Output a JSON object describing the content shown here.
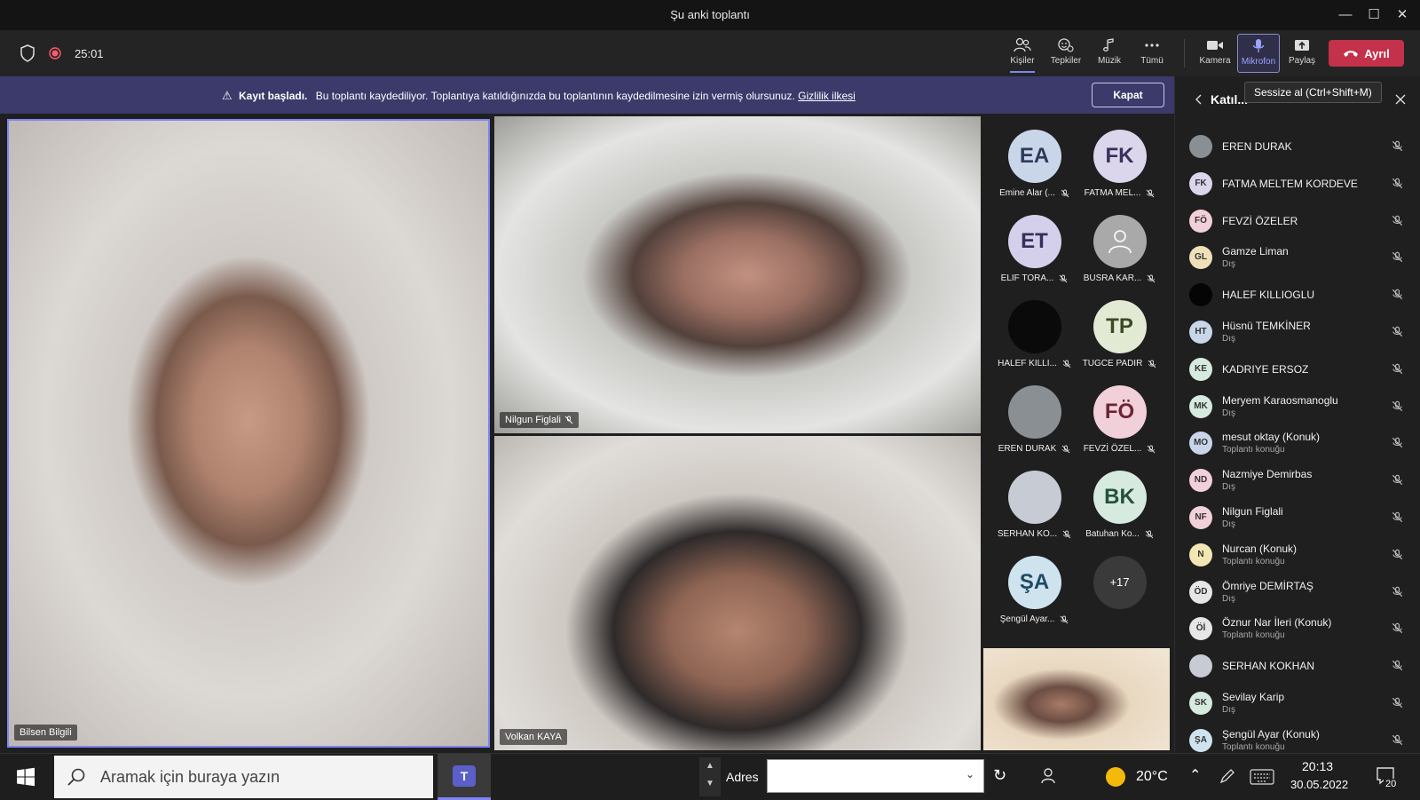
{
  "window": {
    "title": "Şu anki toplantı"
  },
  "toolbar": {
    "timer": "25:01",
    "buttons": {
      "people": "Kişiler",
      "reactions": "Tepkiler",
      "music": "Müzik",
      "more": "Tümü",
      "camera": "Kamera",
      "mic": "Mikrofon",
      "share": "Paylaş"
    },
    "leave": "Ayrıl"
  },
  "banner": {
    "bold": "Kayıt başladı.",
    "text": "Bu toplantı kaydediliyor. Toplantıya katıldığınızda bu toplantının kaydedilmesine izin vermiş olursunuz.",
    "link": "Gizlilik ilkesi",
    "close": "Kapat"
  },
  "videos": {
    "main": "Bilsen Bilgili",
    "top": "Nilgun Figlali",
    "bottom": "Volkan KAYA"
  },
  "gallery": [
    {
      "initials": "EA",
      "label": "Emine Alar (...",
      "bg": "#c9d6ea",
      "fg": "#2d3a59"
    },
    {
      "initials": "FK",
      "label": "FATMA MEL...",
      "bg": "#dcd6ec",
      "fg": "#3b2f5c"
    },
    {
      "initials": "ET",
      "label": "ELIF TORA...",
      "bg": "#d4d0ec",
      "fg": "#34305a"
    },
    {
      "initials": "",
      "label": "BUSRA KAR...",
      "bg": "#a9a9a9",
      "fg": "#ffffff"
    },
    {
      "initials": "",
      "label": "HALEF KILLI...",
      "bg": "#0a0a0a",
      "fg": "#ffffff"
    },
    {
      "initials": "TP",
      "label": "TUGCE PADIR",
      "bg": "#e3ead4",
      "fg": "#3b4a25"
    },
    {
      "initials": "",
      "label": "EREN DURAK",
      "bg": "#8a8f94",
      "fg": "#ffffff"
    },
    {
      "initials": "FÖ",
      "label": "FEVZİ ÖZEL...",
      "bg": "#f2d0d9",
      "fg": "#6b2335"
    },
    {
      "initials": "",
      "label": "SERHAN KO...",
      "bg": "#c7ccd4",
      "fg": "#ffffff"
    },
    {
      "initials": "BK",
      "label": "Batuhan Ko...",
      "bg": "#d6eadf",
      "fg": "#24513a"
    },
    {
      "initials": "ŞA",
      "label": "Şengül Ayar...",
      "bg": "#cfe3ef",
      "fg": "#1f4a62"
    },
    {
      "initials": "+17",
      "label": "",
      "bg": "#3a3a3a",
      "fg": "#ffffff"
    }
  ],
  "panel": {
    "title": "Katıl...",
    "tooltip": "Sessize al (Ctrl+Shift+M)",
    "participants": [
      {
        "initials": "",
        "name": "EREN DURAK",
        "sub": "",
        "bg": "#8a8f94"
      },
      {
        "initials": "FK",
        "name": "FATMA MELTEM KORDEVE",
        "sub": "",
        "bg": "#dcd6ec"
      },
      {
        "initials": "FÖ",
        "name": "FEVZİ ÖZELER",
        "sub": "",
        "bg": "#f2d0d9"
      },
      {
        "initials": "GL",
        "name": "Gamze Liman",
        "sub": "Dış",
        "bg": "#efe0b8"
      },
      {
        "initials": "",
        "name": "HALEF KILLIOGLU",
        "sub": "",
        "bg": "#050505"
      },
      {
        "initials": "HT",
        "name": "Hüsnü TEMKİNER",
        "sub": "Dış",
        "bg": "#c9d6ea"
      },
      {
        "initials": "KE",
        "name": "KADRIYE ERSOZ",
        "sub": "",
        "bg": "#d6eadf"
      },
      {
        "initials": "MK",
        "name": "Meryem Karaosmanoglu",
        "sub": "Dış",
        "bg": "#d6eadf"
      },
      {
        "initials": "MO",
        "name": "mesut oktay (Konuk)",
        "sub": "Toplantı konuğu",
        "bg": "#c9d6ea"
      },
      {
        "initials": "ND",
        "name": "Nazmiye Demirbas",
        "sub": "Dış",
        "bg": "#f2d0d9"
      },
      {
        "initials": "NF",
        "name": "Nilgun Figlali",
        "sub": "Dış",
        "bg": "#f2d0d9"
      },
      {
        "initials": "N",
        "name": "Nurcan (Konuk)",
        "sub": "Toplantı konuğu",
        "bg": "#f3e6b5"
      },
      {
        "initials": "ÖD",
        "name": "Ömriye DEMİRTAŞ",
        "sub": "Dış",
        "bg": "#e6e6e6"
      },
      {
        "initials": "Öİ",
        "name": "Öznur Nar İleri (Konuk)",
        "sub": "Toplantı konuğu",
        "bg": "#e6e6e6"
      },
      {
        "initials": "",
        "name": "SERHAN KOKHAN",
        "sub": "",
        "bg": "#c7ccd4"
      },
      {
        "initials": "SK",
        "name": "Sevilay Karip",
        "sub": "Dış",
        "bg": "#d6eadf"
      },
      {
        "initials": "ŞA",
        "name": "Şengül Ayar (Konuk)",
        "sub": "Toplantı konuğu",
        "bg": "#cfe3ef"
      }
    ]
  },
  "taskbar": {
    "search_placeholder": "Aramak için buraya yazın",
    "address_label": "Adres",
    "temperature": "20°C",
    "time": "20:13",
    "date": "30.05.2022",
    "notifications": "20"
  }
}
